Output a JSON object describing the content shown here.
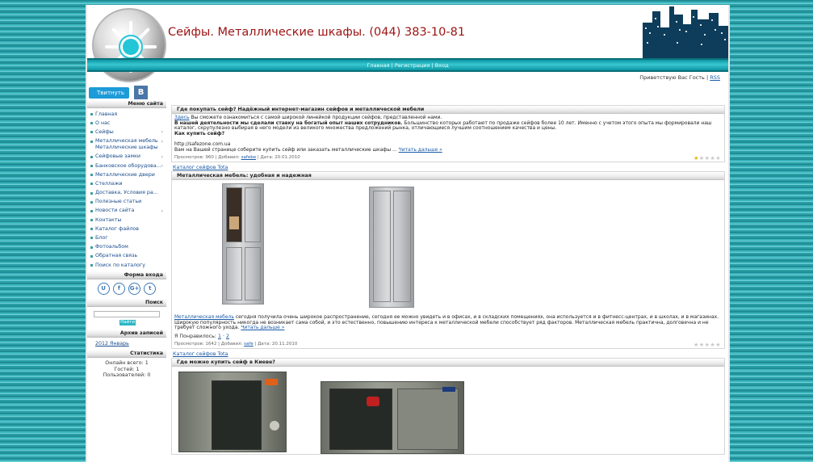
{
  "header": {
    "title": "Сейфы. Металлические шкафы. (044) 383-10-81",
    "topnav": [
      "Главная",
      "Регистрация",
      "Вход"
    ]
  },
  "userbar": {
    "greeting": "Приветствую Вас Гость",
    "rss": "RSS"
  },
  "sidebar": {
    "twitter_label": "Твитнуть",
    "vk_label": "В",
    "menu_title": "Меню сайта",
    "menu": [
      {
        "label": "Главная",
        "arrow": false
      },
      {
        "label": "О нас",
        "arrow": false
      },
      {
        "label": "Сейфы",
        "arrow": true
      },
      {
        "label": "Металлическая мебель Металлические шкафы",
        "arrow": true
      },
      {
        "label": "Сейфовые замки",
        "arrow": true
      },
      {
        "label": "Банковское оборудова...",
        "arrow": true
      },
      {
        "label": "Металлические двери",
        "arrow": false
      },
      {
        "label": "Стеллажи",
        "arrow": false
      },
      {
        "label": "Доставка, Условия ра...",
        "arrow": false
      },
      {
        "label": "Полезные статьи",
        "arrow": false
      },
      {
        "label": "Новости сайта",
        "arrow": true
      },
      {
        "label": "Контакты",
        "arrow": false
      },
      {
        "label": "Каталог файлов",
        "arrow": false
      },
      {
        "label": "Блог",
        "arrow": false
      },
      {
        "label": "Фотоальбом",
        "arrow": false
      },
      {
        "label": "Обратная связь",
        "arrow": false
      },
      {
        "label": "Поиск по каталогу",
        "arrow": false
      }
    ],
    "login_title": "Форма входа",
    "login_icons": [
      "U",
      "f",
      "G+",
      "t"
    ],
    "search_title": "Поиск",
    "search_button": "Найти",
    "archive_title": "Архив записей",
    "archive_link": "2012 Январь",
    "stats_title": "Статистика",
    "stats": [
      "Онлайн всего: 1",
      "Гостей: 1",
      "Пользователей: 0"
    ]
  },
  "posts": [
    {
      "title": "Где покупать сейф? Надёжный интернет-магазин сейфов и металлической мебели",
      "body_link": "Здесь",
      "body_intro": "Вы сможете ознакомиться с самой широкой линейкой продукции сейфов, представленной нами.",
      "body_bold": "В нашей деятельности мы сделали ставку на богатый опыт наших сотрудников.",
      "body_text": "Большинство которых работают по продаже сейфов более 10 лет. Именно с учетом этого опыта мы формировали наш каталог, скрупулезно выбирая в него модели из великого множества предложений рынка, отличающиеся лучшим соотношением качества и цены.",
      "question": "Как купить сейф?",
      "url": "http://safezone.com.ua",
      "tail": "Вам на Вашей странице соберите купить сейф или заказать металлические шкафы ...",
      "more": "Читать дальше »",
      "meta_views": "Просмотров: 960",
      "meta_added": "Добавил:",
      "meta_user": "safebe",
      "meta_date": "Дата: 20.01.2010",
      "rating": 1
    },
    {
      "category": "Каталог сейфов Tota",
      "title": "Металлическая мебель: удобная и надежная",
      "body_link": "Металлическая мебель",
      "body_text": "сегодня получила очень широкое распространение, сегодня ее можно увидеть и в офисах, и в складских помещениях, она используется и в фитнесс-центрах, и в школах, и в магазинах.",
      "body_text2": "Широкую популярность никогда не возникает сама собой, и это естественно, повышению интереса к металлической мебели способствует ряд факторов. Металлическая мебель практична, долговечна и не требует сложного ухода.",
      "more": "Читать дальше »",
      "pages_label": "Я Понравилось:",
      "pages": [
        "1",
        "2"
      ],
      "meta_views": "Просмотров: 1642",
      "meta_added": "Добавил:",
      "meta_user": "safe",
      "meta_date": "Дата: 20.11.2010",
      "rating": 0
    },
    {
      "category": "Каталог сейфов Tota",
      "title": "Где можно купить сейф в Киеве?"
    }
  ]
}
